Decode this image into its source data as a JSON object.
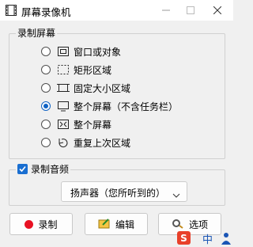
{
  "window": {
    "title": "屏幕录像机"
  },
  "record_screen": {
    "group_label": "录制屏幕",
    "options": [
      {
        "label": "窗口或对象",
        "icon": "window-icon",
        "selected": false
      },
      {
        "label": "矩形区域",
        "icon": "dashed-rect-icon",
        "selected": false
      },
      {
        "label": "固定大小区域",
        "icon": "fixed-area-icon",
        "selected": false
      },
      {
        "label": "整个屏幕（不含任务栏）",
        "icon": "monitor-icon",
        "selected": true
      },
      {
        "label": "整个屏幕",
        "icon": "fullscreen-icon",
        "selected": false
      },
      {
        "label": "重复上次区域",
        "icon": "repeat-icon",
        "selected": false
      }
    ]
  },
  "record_audio": {
    "checkbox_label": "录制音频",
    "checked": true,
    "source_value": "扬声器（您所听到的）"
  },
  "buttons": {
    "record": "录制",
    "edit": "编辑",
    "options": "选项"
  },
  "tray": {
    "ime": "中"
  },
  "colors": {
    "accent": "#1063c4",
    "record_dot": "#e81123"
  }
}
